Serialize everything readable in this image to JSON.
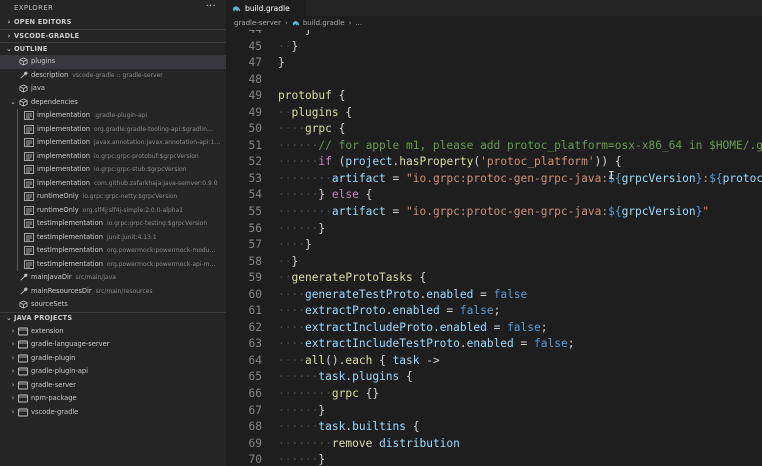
{
  "sidebar": {
    "title": "EXPLORER",
    "more_label": "···",
    "sections": {
      "open_editors": "OPEN EDITORS",
      "project": "VSCODE-GRADLE",
      "outline": "OUTLINE",
      "java_projects": "JAVA PROJECTS"
    },
    "outline": [
      {
        "label": "plugins",
        "desc": "",
        "indent": 1,
        "twisty": "",
        "icon": "cube-icon",
        "selected": true
      },
      {
        "label": "description",
        "desc": "vscode-gradle :: gradle-server",
        "indent": 1,
        "twisty": "",
        "icon": "wrench-icon"
      },
      {
        "label": "java",
        "desc": "",
        "indent": 1,
        "twisty": "",
        "icon": "cube-icon"
      },
      {
        "label": "dependencies",
        "desc": "",
        "indent": 0,
        "twisty": "⌄",
        "icon": "cube-icon"
      },
      {
        "label": "implementation",
        "desc": ":gradle-plugin-api",
        "indent": 2,
        "twisty": "",
        "icon": "list-icon"
      },
      {
        "label": "implementation",
        "desc": "org.gradle:gradle-tooling-api:$gradlin…",
        "indent": 2,
        "twisty": "",
        "icon": "list-icon"
      },
      {
        "label": "implementation",
        "desc": "javax.annotation:javax.annotation-api:1…",
        "indent": 2,
        "twisty": "",
        "icon": "list-icon"
      },
      {
        "label": "implementation",
        "desc": "io.grpc:grpc-protobuf:$grpcVersion",
        "indent": 2,
        "twisty": "",
        "icon": "list-icon"
      },
      {
        "label": "implementation",
        "desc": "io.grpc:grpc-stub:$grpcVersion",
        "indent": 2,
        "twisty": "",
        "icon": "list-icon"
      },
      {
        "label": "implementation",
        "desc": "com.github.zafarkhaja:java-semver:0.9.0",
        "indent": 2,
        "twisty": "",
        "icon": "list-icon"
      },
      {
        "label": "runtimeOnly",
        "desc": "io.grpc:grpc-netty:$grpcVersion",
        "indent": 2,
        "twisty": "",
        "icon": "list-icon"
      },
      {
        "label": "runtimeOnly",
        "desc": "org.slf4j:slf4j-simple:2.0.0-alpha1",
        "indent": 2,
        "twisty": "",
        "icon": "list-icon"
      },
      {
        "label": "testImplementation",
        "desc": "io.grpc:grpc-testing:$grpcVersion",
        "indent": 2,
        "twisty": "",
        "icon": "list-icon"
      },
      {
        "label": "testImplementation",
        "desc": "junit:junit:4.13.1",
        "indent": 2,
        "twisty": "",
        "icon": "list-icon"
      },
      {
        "label": "testImplementation",
        "desc": "org.powermock:powermock-modu…",
        "indent": 2,
        "twisty": "",
        "icon": "list-icon"
      },
      {
        "label": "testImplementation",
        "desc": "org.powermock:powermock-api-m…",
        "indent": 2,
        "twisty": "",
        "icon": "list-icon"
      },
      {
        "label": "mainJavaDir",
        "desc": "src/main/java",
        "indent": 1,
        "twisty": "",
        "icon": "wrench-icon"
      },
      {
        "label": "mainResourcesDir",
        "desc": "src/main/resources",
        "indent": 1,
        "twisty": "",
        "icon": "wrench-icon"
      },
      {
        "label": "sourceSets",
        "desc": "",
        "indent": 1,
        "twisty": "",
        "icon": "cube-icon"
      }
    ],
    "java_projects": [
      {
        "label": "extension"
      },
      {
        "label": "gradle-language-server"
      },
      {
        "label": "gradle-plugin"
      },
      {
        "label": "gradle-plugin-api"
      },
      {
        "label": "gradle-server"
      },
      {
        "label": "npm-package"
      },
      {
        "label": "vscode-gradle"
      }
    ]
  },
  "tab": {
    "label": "build.gradle",
    "icon": "gradle-elephant-icon"
  },
  "breadcrumb": {
    "folder": "gradle-server",
    "file": "build.gradle",
    "tail": "..."
  },
  "code_lines": [
    {
      "n": "44",
      "indent": 2,
      "tokens": [
        [
          "",
          "}"
        ]
      ]
    },
    {
      "n": "45",
      "indent": 1,
      "tokens": [
        [
          "",
          "}"
        ]
      ]
    },
    {
      "n": "47",
      "indent": 0,
      "tokens": [
        [
          "",
          "}"
        ]
      ]
    },
    {
      "n": "48",
      "indent": 0,
      "tokens": []
    },
    {
      "n": "49",
      "indent": 0,
      "tokens": [
        [
          "fn",
          "protobuf"
        ],
        [
          "",
          " {"
        ]
      ]
    },
    {
      "n": "49",
      "indent": 1,
      "tokens": [
        [
          "fn",
          "plugins"
        ],
        [
          "",
          " {"
        ]
      ]
    },
    {
      "n": "50",
      "indent": 2,
      "tokens": [
        [
          "fn",
          "grpc"
        ],
        [
          "",
          " {"
        ]
      ]
    },
    {
      "n": "51",
      "indent": 3,
      "tokens": [
        [
          "cm",
          "// for apple m1, please add protoc_platform=osx-x86_64 in $HOME/.g"
        ]
      ]
    },
    {
      "n": "52",
      "indent": 3,
      "tokens": [
        [
          "ctl",
          "if"
        ],
        [
          "",
          " ("
        ],
        [
          "id",
          "project"
        ],
        [
          "",
          "."
        ],
        [
          "fn",
          "hasProperty"
        ],
        [
          "",
          "("
        ],
        [
          "str",
          "'protoc_platform'"
        ],
        [
          "",
          ")) {"
        ]
      ]
    },
    {
      "n": "53",
      "indent": 4,
      "tokens": [
        [
          "id",
          "artifact"
        ],
        [
          "",
          " = "
        ],
        [
          "str",
          "\"io.grpc:protoc-gen-grpc-java:"
        ],
        [
          "kw",
          "${"
        ],
        [
          "id",
          "grpcVersion"
        ],
        [
          "kw",
          "}"
        ],
        [
          "str",
          ":"
        ],
        [
          "kw",
          "${"
        ],
        [
          "id",
          "protoc"
        ]
      ]
    },
    {
      "n": "54",
      "indent": 3,
      "tokens": [
        [
          "",
          "} "
        ],
        [
          "ctl",
          "else"
        ],
        [
          "",
          " {"
        ]
      ]
    },
    {
      "n": "55",
      "indent": 4,
      "tokens": [
        [
          "id",
          "artifact"
        ],
        [
          "",
          " = "
        ],
        [
          "str",
          "\"io.grpc:protoc-gen-grpc-java:"
        ],
        [
          "kw",
          "${"
        ],
        [
          "id",
          "grpcVersion"
        ],
        [
          "kw",
          "}"
        ],
        [
          "str",
          "\""
        ]
      ]
    },
    {
      "n": "56",
      "indent": 3,
      "tokens": [
        [
          "",
          "}"
        ]
      ]
    },
    {
      "n": "57",
      "indent": 2,
      "tokens": [
        [
          "",
          "}"
        ]
      ]
    },
    {
      "n": "58",
      "indent": 1,
      "tokens": [
        [
          "",
          "}"
        ]
      ]
    },
    {
      "n": "59",
      "indent": 1,
      "tokens": [
        [
          "fn",
          "generateProtoTasks"
        ],
        [
          "",
          " {"
        ]
      ]
    },
    {
      "n": "60",
      "indent": 2,
      "tokens": [
        [
          "id",
          "generateTestProto"
        ],
        [
          "",
          "."
        ],
        [
          "id",
          "enabled"
        ],
        [
          "",
          " = "
        ],
        [
          "kw",
          "false"
        ]
      ]
    },
    {
      "n": "61",
      "indent": 2,
      "tokens": [
        [
          "id",
          "extractProto"
        ],
        [
          "",
          "."
        ],
        [
          "id",
          "enabled"
        ],
        [
          "",
          " = "
        ],
        [
          "kw",
          "false"
        ],
        [
          "",
          ";"
        ]
      ]
    },
    {
      "n": "62",
      "indent": 2,
      "tokens": [
        [
          "id",
          "extractIncludeProto"
        ],
        [
          "",
          "."
        ],
        [
          "id",
          "enabled"
        ],
        [
          "",
          " = "
        ],
        [
          "kw",
          "false"
        ],
        [
          "",
          ";"
        ]
      ]
    },
    {
      "n": "63",
      "indent": 2,
      "tokens": [
        [
          "id",
          "extractIncludeTestProto"
        ],
        [
          "",
          "."
        ],
        [
          "id",
          "enabled"
        ],
        [
          "",
          " = "
        ],
        [
          "kw",
          "false"
        ],
        [
          "",
          ";"
        ]
      ]
    },
    {
      "n": "64",
      "indent": 2,
      "tokens": [
        [
          "fn",
          "all"
        ],
        [
          "",
          "()."
        ],
        [
          "fn",
          "each"
        ],
        [
          "",
          " { "
        ],
        [
          "id",
          "task"
        ],
        [
          "",
          " ->"
        ]
      ]
    },
    {
      "n": "65",
      "indent": 3,
      "tokens": [
        [
          "id",
          "task"
        ],
        [
          "",
          "."
        ],
        [
          "id",
          "plugins"
        ],
        [
          "",
          " {"
        ]
      ]
    },
    {
      "n": "66",
      "indent": 4,
      "tokens": [
        [
          "fn",
          "grpc"
        ],
        [
          "",
          " {}"
        ]
      ]
    },
    {
      "n": "67",
      "indent": 3,
      "tokens": [
        [
          "",
          "}"
        ]
      ]
    },
    {
      "n": "68",
      "indent": 3,
      "tokens": [
        [
          "id",
          "task"
        ],
        [
          "",
          "."
        ],
        [
          "id",
          "builtins"
        ],
        [
          "",
          " {"
        ]
      ]
    },
    {
      "n": "69",
      "indent": 4,
      "tokens": [
        [
          "fn",
          "remove"
        ],
        [
          "",
          " "
        ],
        [
          "id",
          "distribution"
        ]
      ]
    },
    {
      "n": "70",
      "indent": 3,
      "tokens": [
        [
          "",
          "}"
        ]
      ]
    }
  ]
}
